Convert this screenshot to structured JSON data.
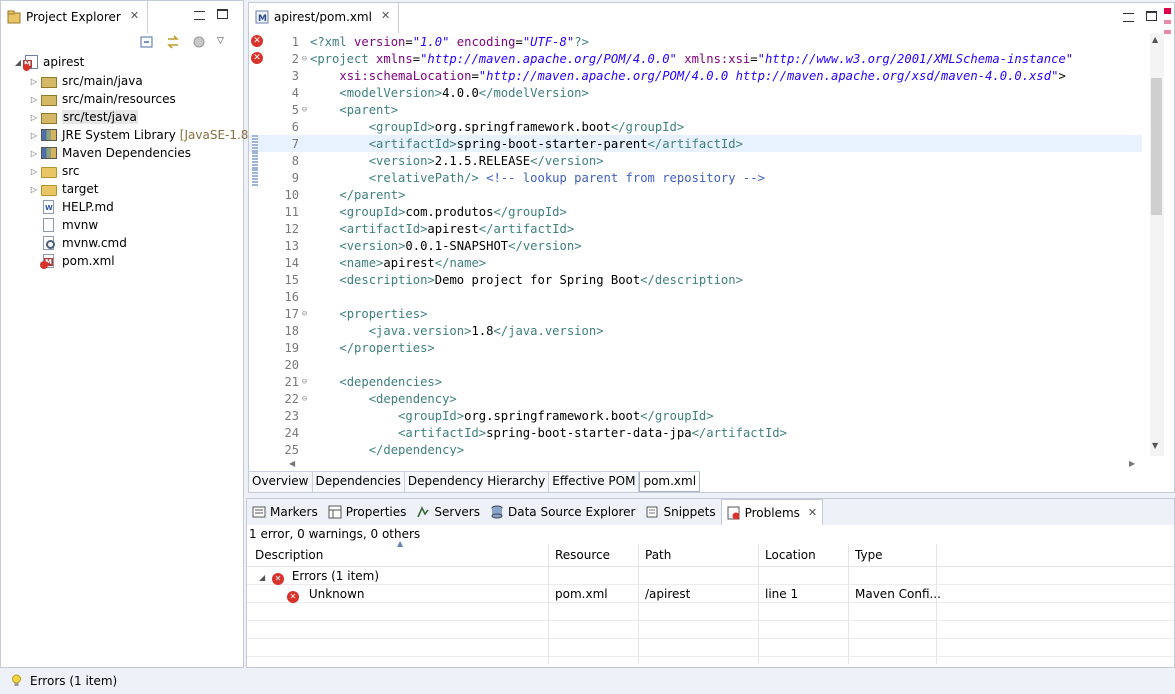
{
  "explorer": {
    "title": "Project Explorer",
    "tree": [
      {
        "label": "apirest",
        "icon": "maven-project-icon",
        "level": 0,
        "expanded": true
      },
      {
        "label": "src/main/java",
        "icon": "source-folder-icon",
        "level": 1
      },
      {
        "label": "src/main/resources",
        "icon": "source-folder-icon",
        "level": 1
      },
      {
        "label": "src/test/java",
        "icon": "source-folder-icon",
        "level": 1
      },
      {
        "label": "JRE System Library",
        "tag": "[JavaSE-1.8]",
        "icon": "library-icon",
        "level": 1
      },
      {
        "label": "Maven Dependencies",
        "icon": "library-icon",
        "level": 1
      },
      {
        "label": "src",
        "icon": "folder-icon",
        "level": 1
      },
      {
        "label": "target",
        "icon": "folder-icon",
        "level": 1
      },
      {
        "label": "HELP.md",
        "icon": "markdown-file-icon",
        "level": 1
      },
      {
        "label": "mvnw",
        "icon": "text-file-icon",
        "level": 1
      },
      {
        "label": "mvnw.cmd",
        "icon": "script-file-icon",
        "level": 1
      },
      {
        "label": "pom.xml",
        "icon": "xml-file-error-icon",
        "level": 1
      }
    ]
  },
  "editor": {
    "tab_title": "apirest/pom.xml",
    "lines": [
      {
        "n": "1",
        "text": "<?xml version=\"1.0\" encoding=\"UTF-8\"?>"
      },
      {
        "n": "2",
        "text": "<project xmlns=\"http://maven.apache.org/POM/4.0.0\" xmlns:xsi=\"http://www.w3.org/2001/XMLSchema-instance\""
      },
      {
        "n": "3",
        "text": "    xsi:schemaLocation=\"http://maven.apache.org/POM/4.0.0 http://maven.apache.org/xsd/maven-4.0.0.xsd\">"
      },
      {
        "n": "4",
        "text": "    <modelVersion>4.0.0</modelVersion>"
      },
      {
        "n": "5",
        "text": "    <parent>"
      },
      {
        "n": "6",
        "text": "        <groupId>org.springframework.boot</groupId>"
      },
      {
        "n": "7",
        "text": "        <artifactId>spring-boot-starter-parent</artifactId>"
      },
      {
        "n": "8",
        "text": "        <version>2.1.5.RELEASE</version>"
      },
      {
        "n": "9",
        "text": "        <relativePath/> <!-- lookup parent from repository -->"
      },
      {
        "n": "10",
        "text": "    </parent>"
      },
      {
        "n": "11",
        "text": "    <groupId>com.produtos</groupId>"
      },
      {
        "n": "12",
        "text": "    <artifactId>apirest</artifactId>"
      },
      {
        "n": "13",
        "text": "    <version>0.0.1-SNAPSHOT</version>"
      },
      {
        "n": "14",
        "text": "    <name>apirest</name>"
      },
      {
        "n": "15",
        "text": "    <description>Demo project for Spring Boot</description>"
      },
      {
        "n": "16",
        "text": ""
      },
      {
        "n": "17",
        "text": "    <properties>"
      },
      {
        "n": "18",
        "text": "        <java.version>1.8</java.version>"
      },
      {
        "n": "19",
        "text": "    </properties>"
      },
      {
        "n": "20",
        "text": ""
      },
      {
        "n": "21",
        "text": "    <dependencies>"
      },
      {
        "n": "22",
        "text": "        <dependency>"
      },
      {
        "n": "23",
        "text": "            <groupId>org.springframework.boot</groupId>"
      },
      {
        "n": "24",
        "text": "            <artifactId>spring-boot-starter-data-jpa</artifactId>"
      },
      {
        "n": "25",
        "text": "        </dependency>"
      }
    ],
    "page_tabs": [
      "Overview",
      "Dependencies",
      "Dependency Hierarchy",
      "Effective POM",
      "pom.xml"
    ],
    "active_page_tab": "pom.xml"
  },
  "bottom": {
    "tabs": [
      {
        "label": "Markers",
        "icon": "markers-icon"
      },
      {
        "label": "Properties",
        "icon": "properties-icon"
      },
      {
        "label": "Servers",
        "icon": "servers-icon"
      },
      {
        "label": "Data Source Explorer",
        "icon": "data-source-icon"
      },
      {
        "label": "Snippets",
        "icon": "snippets-icon"
      },
      {
        "label": "Problems",
        "icon": "problems-icon"
      }
    ],
    "active_tab": "Problems",
    "summary": "1 error, 0 warnings, 0 others",
    "columns": [
      "Description",
      "Resource",
      "Path",
      "Location",
      "Type"
    ],
    "group": {
      "label": "Errors (1 item)"
    },
    "rows": [
      {
        "description": "Unknown",
        "resource": "pom.xml",
        "path": "/apirest",
        "location": "line 1",
        "type": "Maven Confi..."
      }
    ]
  },
  "status": {
    "text": "Errors (1 item)"
  },
  "colors": {
    "error": "#d9322b",
    "xml_tag": "#3f7f7f",
    "xml_attr": "#7f007f",
    "xml_value": "#2a00ff",
    "xml_comment": "#3f5fbf"
  }
}
